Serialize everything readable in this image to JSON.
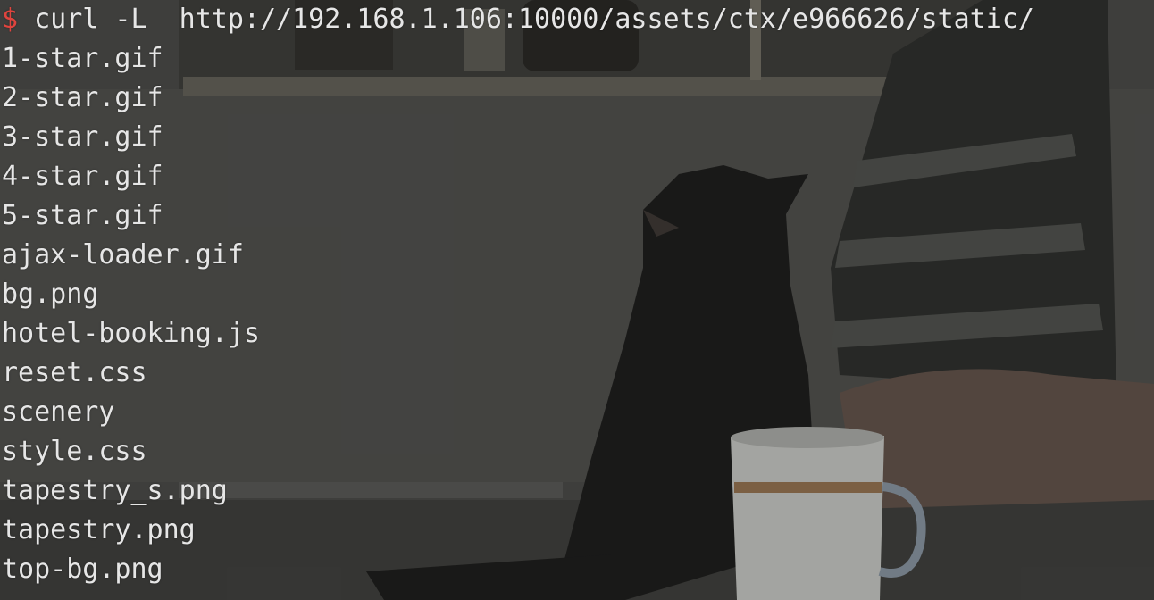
{
  "terminal": {
    "prompt": "$",
    "command": "curl -L  http://192.168.1.106:10000/assets/ctx/e966626/static/",
    "output": [
      "1-star.gif",
      "2-star.gif",
      "3-star.gif",
      "4-star.gif",
      "5-star.gif",
      "ajax-loader.gif",
      "bg.png",
      "hotel-booking.js",
      "reset.css",
      "scenery",
      "style.css",
      "tapestry_s.png",
      "tapestry.png",
      "top-bg.png"
    ]
  },
  "colors": {
    "background": "#3d3d3a",
    "text": "#e6e6e6",
    "prompt": "#e0443e"
  }
}
